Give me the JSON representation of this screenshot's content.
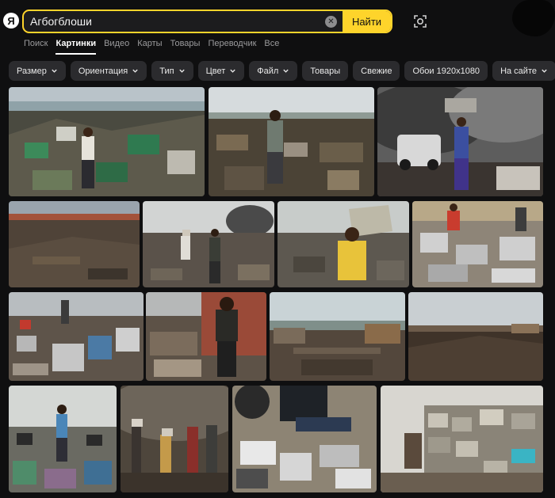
{
  "search": {
    "logo": "Я",
    "query": "Агбогблоши",
    "clear_icon": "close-icon",
    "submit_label": "Найти",
    "camera_icon": "camera-search-icon"
  },
  "nav": {
    "tabs": [
      "Поиск",
      "Картинки",
      "Видео",
      "Карты",
      "Товары",
      "Переводчик",
      "Все"
    ],
    "active": "Картинки"
  },
  "filters": {
    "size": "Размер",
    "orientation": "Ориентация",
    "type": "Тип",
    "color": "Цвет",
    "file": "Файл",
    "goods": "Товары",
    "fresh": "Свежие",
    "wallpaper": "Обои 1920x1080",
    "on_site": "На сайте"
  },
  "colors": {
    "accent": "#fed42b",
    "background": "#0f0f10",
    "chip": "#2b2b2e"
  },
  "results": {
    "count": 16,
    "subjects": [
      "e-waste-dump-with-boy",
      "man-walking-on-scrap-field",
      "boy-carrying-monitor-near-smoke",
      "dumpsite-overview",
      "men-on-smoky-dump",
      "boy-carrying-stone",
      "scrap-piles-with-workers",
      "market-workers-sorting-scrap",
      "man-by-shacks",
      "dump-panorama",
      "dusk-scrapyard",
      "boy-standing-in-field",
      "workers-in-smoke",
      "person-sitting-on-keyboards",
      "stacked-computer-cases"
    ]
  }
}
